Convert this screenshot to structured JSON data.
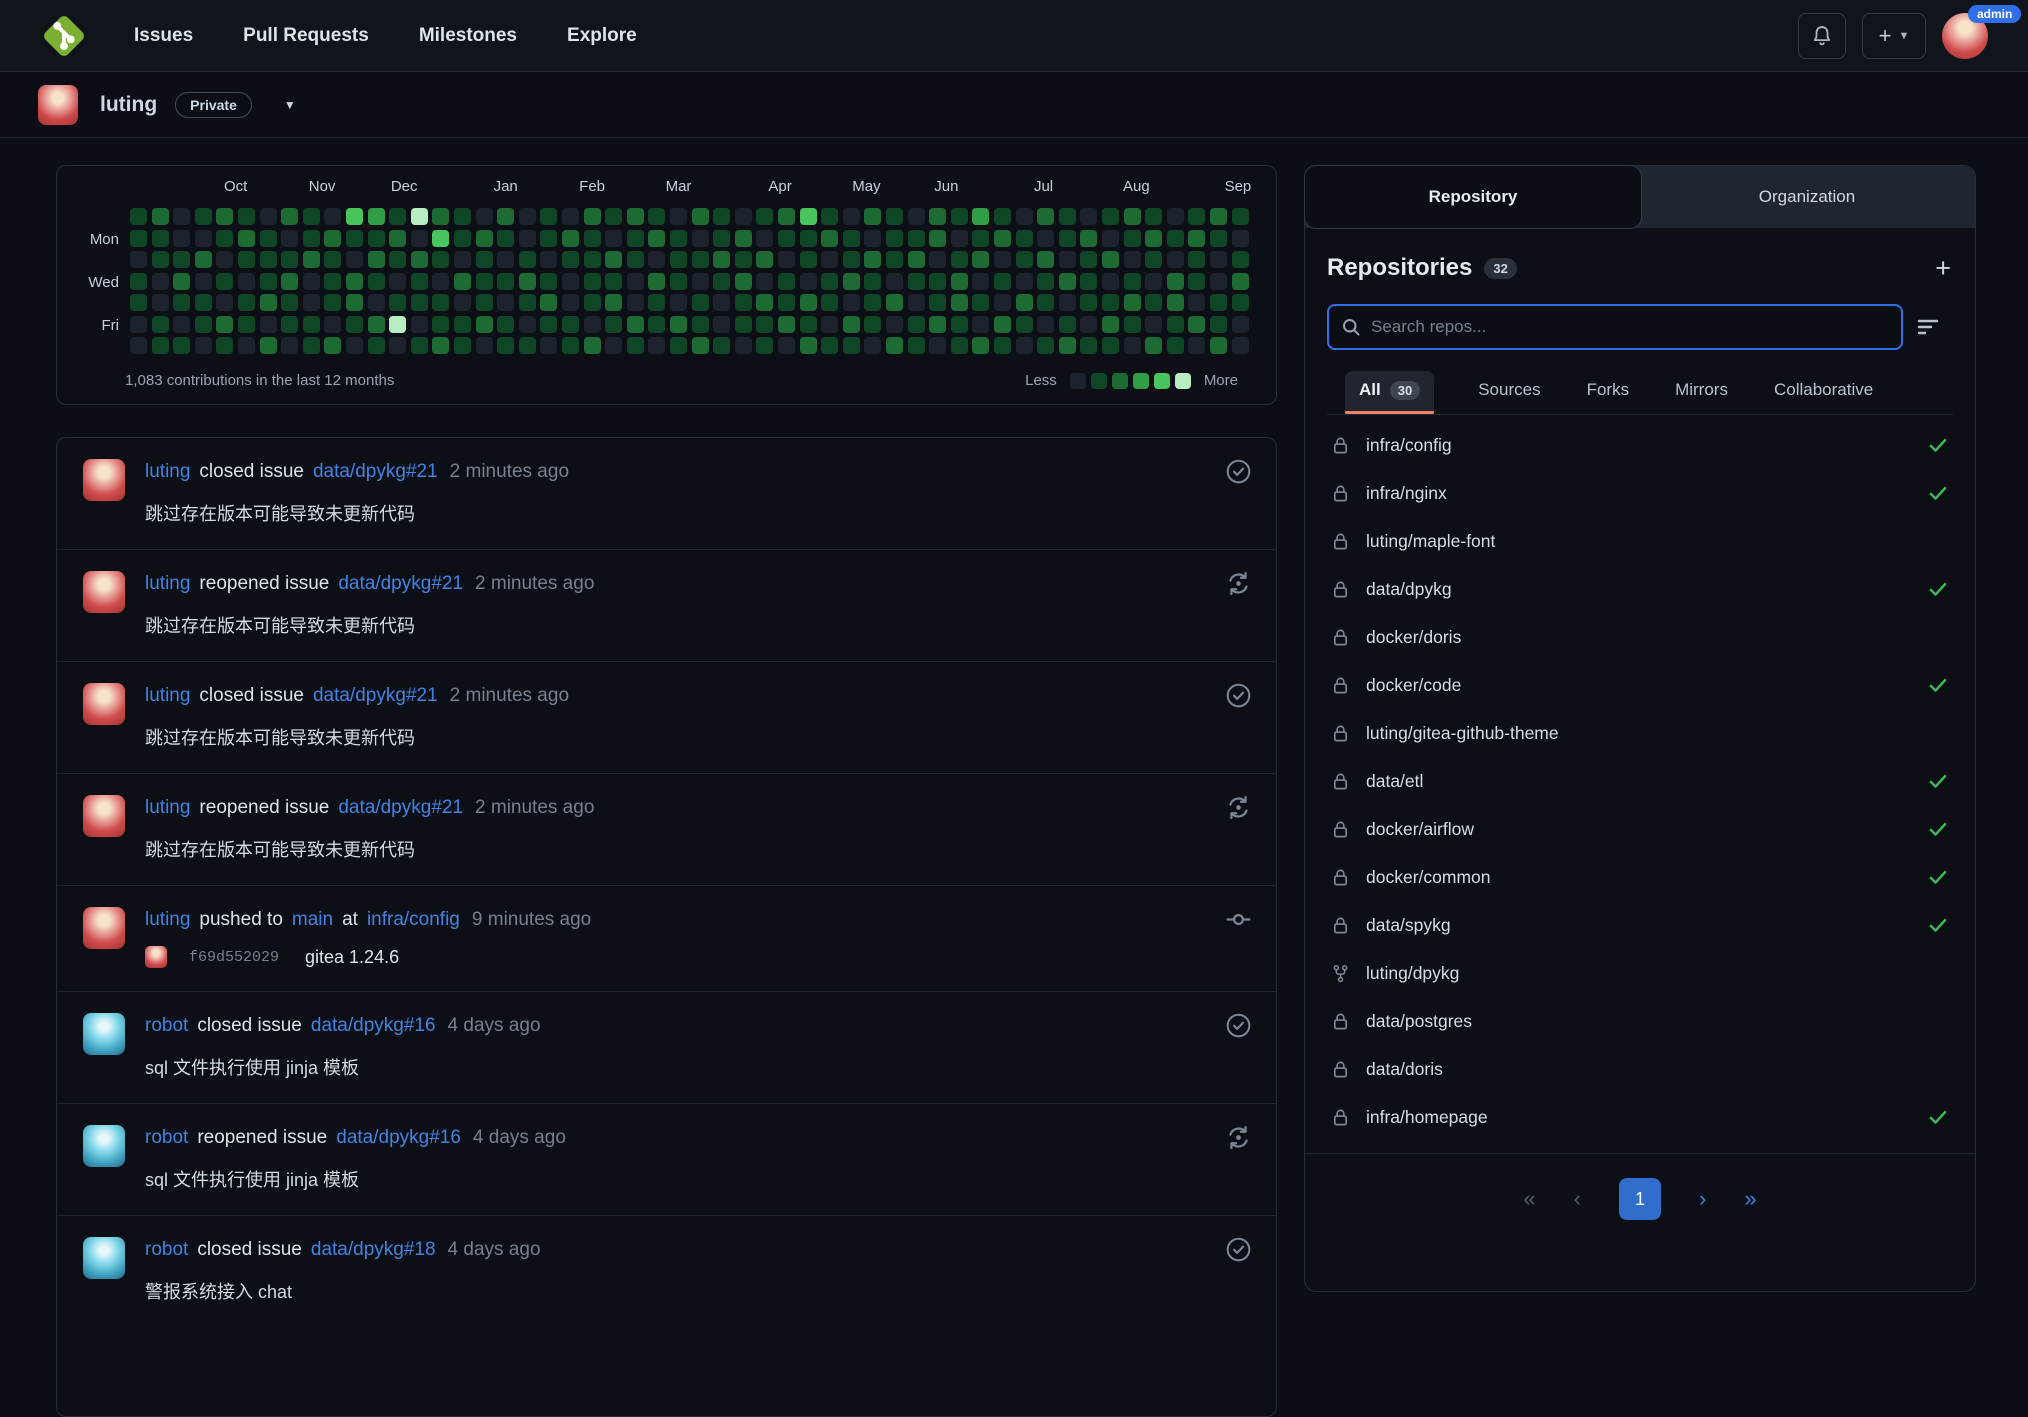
{
  "navbar": {
    "items": [
      "Issues",
      "Pull Requests",
      "Milestones",
      "Explore"
    ],
    "admin_badge": "admin",
    "new_button": "+"
  },
  "profile": {
    "username": "luting",
    "badge": "Private"
  },
  "heatmap": {
    "summary": "1,083 contributions in the last 12 months",
    "less_label": "Less",
    "more_label": "More",
    "months": [
      {
        "label": "Oct",
        "week": 4.5
      },
      {
        "label": "Nov",
        "week": 8.5
      },
      {
        "label": "Dec",
        "week": 12.3
      },
      {
        "label": "Jan",
        "week": 17.0
      },
      {
        "label": "Feb",
        "week": 21.0
      },
      {
        "label": "Mar",
        "week": 25.0
      },
      {
        "label": "Apr",
        "week": 29.7
      },
      {
        "label": "May",
        "week": 33.7
      },
      {
        "label": "Jun",
        "week": 37.4
      },
      {
        "label": "Jul",
        "week": 41.9
      },
      {
        "label": "Aug",
        "week": 46.2
      },
      {
        "label": "Sep",
        "week": 50.9
      }
    ],
    "day_labels": [
      {
        "label": "Mon",
        "row": 1
      },
      {
        "label": "Wed",
        "row": 3
      },
      {
        "label": "Fri",
        "row": 5
      }
    ],
    "level_colors": [
      "#1d232c",
      "#0f4626",
      "#1d6a33",
      "#2f9e44",
      "#48c55c",
      "#b8eec2"
    ],
    "weeks": [
      "1101100",
      "2110011",
      "0012101",
      "1020110",
      "2101021",
      "1210110",
      "0111202",
      "2012110",
      "1120011",
      "0211102",
      "4102210",
      "3121021",
      "1210150",
      "5021101",
      "2410112",
      "1102011",
      "0211120",
      "2101011",
      "0012101",
      "1101210",
      "0210011",
      "2111102",
      "1021210",
      "2110021",
      "1202110",
      "0111021",
      "2010112",
      "1121001",
      "0212110",
      "1020211",
      "2101120",
      "4110212",
      "1201101",
      "0112021",
      "2021110",
      "1110202",
      "0121011",
      "2201120",
      "1012211",
      "3120102",
      "1201021",
      "0110210",
      "2021101",
      "1102012",
      "0211101",
      "1020121",
      "2101210",
      "1210102",
      "0102211",
      "1211020",
      "2100112",
      "1012100"
    ]
  },
  "feed": {
    "items": [
      {
        "user": "luting",
        "avatar": "luting",
        "action": "closed issue",
        "repo": "data/dpykg#21",
        "time": "2 minutes ago",
        "body": "跳过存在版本可能导致未更新代码",
        "icon": "issue-closed"
      },
      {
        "user": "luting",
        "avatar": "luting",
        "action": "reopened issue",
        "repo": "data/dpykg#21",
        "time": "2 minutes ago",
        "body": "跳过存在版本可能导致未更新代码",
        "icon": "issue-reopened"
      },
      {
        "user": "luting",
        "avatar": "luting",
        "action": "closed issue",
        "repo": "data/dpykg#21",
        "time": "2 minutes ago",
        "body": "跳过存在版本可能导致未更新代码",
        "icon": "issue-closed"
      },
      {
        "user": "luting",
        "avatar": "luting",
        "action": "reopened issue",
        "repo": "data/dpykg#21",
        "time": "2 minutes ago",
        "body": "跳过存在版本可能导致未更新代码",
        "icon": "issue-reopened"
      },
      {
        "user": "luting",
        "avatar": "luting",
        "action": "pushed to",
        "branch": "main",
        "preposition": "at",
        "repo": "infra/config",
        "time": "9 minutes ago",
        "icon": "commit",
        "commit": {
          "sha": "f69d552029",
          "message": "gitea 1.24.6"
        }
      },
      {
        "user": "robot",
        "avatar": "robot",
        "action": "closed issue",
        "repo": "data/dpykg#16",
        "time": "4 days ago",
        "body": "sql 文件执行使用 jinja 模板",
        "icon": "issue-closed"
      },
      {
        "user": "robot",
        "avatar": "robot",
        "action": "reopened issue",
        "repo": "data/dpykg#16",
        "time": "4 days ago",
        "body": "sql 文件执行使用 jinja 模板",
        "icon": "issue-reopened"
      },
      {
        "user": "robot",
        "avatar": "robot",
        "action": "closed issue",
        "repo": "data/dpykg#18",
        "time": "4 days ago",
        "body": "警报系统接入 chat",
        "icon": "issue-closed"
      }
    ]
  },
  "panel": {
    "tabs": {
      "repository": "Repository",
      "organization": "Organization"
    },
    "heading": "Repositories",
    "count": "32",
    "add_label": "+",
    "search_placeholder": "Search repos...",
    "filters": [
      {
        "label": "All",
        "count": "30",
        "active": true
      },
      {
        "label": "Sources"
      },
      {
        "label": "Forks"
      },
      {
        "label": "Mirrors"
      },
      {
        "label": "Collaborative"
      }
    ],
    "repos": [
      {
        "name": "infra/config",
        "icon": "lock",
        "check": true
      },
      {
        "name": "infra/nginx",
        "icon": "lock",
        "check": true
      },
      {
        "name": "luting/maple-font",
        "icon": "lock",
        "check": false
      },
      {
        "name": "data/dpykg",
        "icon": "lock",
        "check": true
      },
      {
        "name": "docker/doris",
        "icon": "lock",
        "check": false
      },
      {
        "name": "docker/code",
        "icon": "lock",
        "check": true
      },
      {
        "name": "luting/gitea-github-theme",
        "icon": "lock",
        "check": false
      },
      {
        "name": "data/etl",
        "icon": "lock",
        "check": true
      },
      {
        "name": "docker/airflow",
        "icon": "lock",
        "check": true
      },
      {
        "name": "docker/common",
        "icon": "lock",
        "check": true
      },
      {
        "name": "data/spykg",
        "icon": "lock",
        "check": true
      },
      {
        "name": "luting/dpykg",
        "icon": "fork",
        "check": false
      },
      {
        "name": "data/postgres",
        "icon": "lock",
        "check": false
      },
      {
        "name": "data/doris",
        "icon": "lock",
        "check": false
      },
      {
        "name": "infra/homepage",
        "icon": "lock",
        "check": true
      }
    ],
    "pagination": {
      "first": "«",
      "prev": "‹",
      "page": "1",
      "next": "›",
      "last": "»"
    },
    "colors": {
      "check_green": "#3fb950",
      "active_page_blue": "#316dca",
      "tab_underline": "#f78166",
      "link_blue": "#4184e4"
    }
  }
}
